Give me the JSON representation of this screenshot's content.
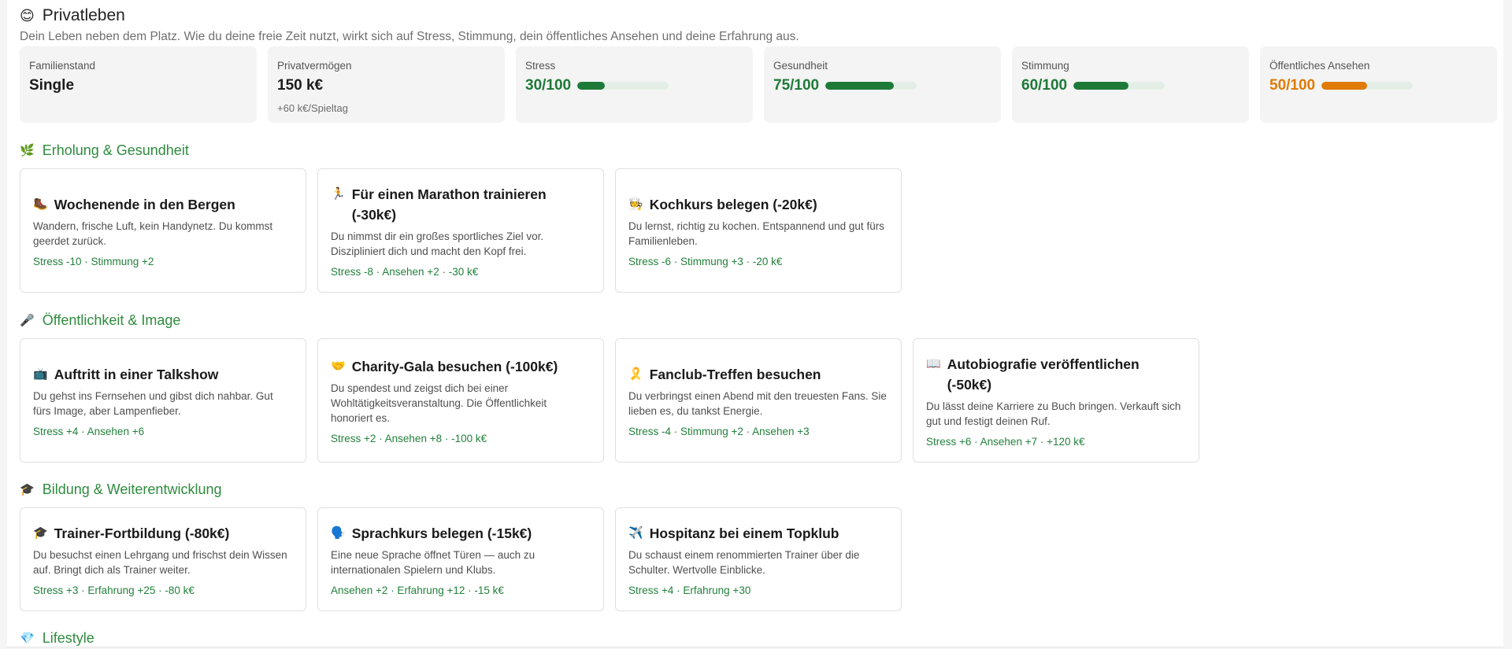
{
  "header": {
    "emoji": "😊",
    "title": "Privatleben",
    "description": "Dein Leben neben dem Platz. Wie du deine freie Zeit nutzt, wirkt sich auf Stress, Stimmung, dein öffentliches Ansehen und deine Erfahrung aus."
  },
  "stats": [
    {
      "label": "Familienstand",
      "value": "Single"
    },
    {
      "label": "Privatvermögen",
      "value": "150 k€",
      "sub": "+60 k€/Spieltag"
    },
    {
      "label": "Stress",
      "value": "30/100",
      "level": 30,
      "color": "#1e7a38"
    },
    {
      "label": "Gesundheit",
      "value": "75/100",
      "level": 75,
      "color": "#1e7a38"
    },
    {
      "label": "Stimmung",
      "value": "60/100",
      "level": 60,
      "color": "#1e7a38"
    },
    {
      "label": "Öffentliches Ansehen",
      "value": "50/100",
      "level": 50,
      "color": "#df7b06"
    }
  ],
  "sections": [
    {
      "emoji": "🌿",
      "title": "Erholung & Gesundheit",
      "cards": [
        {
          "emoji": "🥾",
          "title": "Wochenende in den Bergen",
          "desc": "Wandern, frische Luft, kein Handynetz. Du kommst geerdet zurück.",
          "effects": "Stress -10 · Stimmung +2"
        },
        {
          "emoji": "🏃",
          "title": "Für einen Marathon trainieren (-30k€)",
          "desc": "Du nimmst dir ein großes sportliches Ziel vor. Diszipliniert dich und macht den Kopf frei.",
          "effects": "Stress -8 · Ansehen +2 · -30 k€"
        },
        {
          "emoji": "🧑‍🍳",
          "title": "Kochkurs belegen (-20k€)",
          "desc": "Du lernst, richtig zu kochen. Entspannend und gut fürs Familienleben.",
          "effects": "Stress -6 · Stimmung +3 · -20 k€"
        }
      ]
    },
    {
      "emoji": "🎤",
      "title": "Öffentlichkeit & Image",
      "cards": [
        {
          "emoji": "📺",
          "title": "Auftritt in einer Talkshow",
          "desc": "Du gehst ins Fernsehen und gibst dich nahbar. Gut fürs Image, aber Lampenfieber.",
          "effects": "Stress +4 · Ansehen +6"
        },
        {
          "emoji": "🤝",
          "title": "Charity-Gala besuchen (-100k€)",
          "desc": "Du spendest und zeigst dich bei einer Wohltätigkeitsveranstaltung. Die Öffentlichkeit honoriert es.",
          "effects": "Stress +2 · Ansehen +8 · -100 k€"
        },
        {
          "emoji": "🎗️",
          "title": "Fanclub-Treffen besuchen",
          "desc": "Du verbringst einen Abend mit den treuesten Fans. Sie lieben es, du tankst Energie.",
          "effects": "Stress -4 · Stimmung +2 · Ansehen +3"
        },
        {
          "emoji": "📖",
          "title": "Autobiografie veröffentlichen (-50k€)",
          "desc": "Du lässt deine Karriere zu Buch bringen. Verkauft sich gut und festigt deinen Ruf.",
          "effects": "Stress +6 · Ansehen +7 · +120 k€"
        }
      ]
    },
    {
      "emoji": "🎓",
      "title": "Bildung & Weiterentwicklung",
      "cards": [
        {
          "emoji": "🎓",
          "title": "Trainer-Fortbildung (-80k€)",
          "desc": "Du besuchst einen Lehrgang und frischst dein Wissen auf. Bringt dich als Trainer weiter.",
          "effects": "Stress +3 · Erfahrung +25 · -80 k€"
        },
        {
          "emoji": "🗣️",
          "title": "Sprachkurs belegen (-15k€)",
          "desc": "Eine neue Sprache öffnet Türen — auch zu internationalen Spielern und Klubs.",
          "effects": "Ansehen +2 · Erfahrung +12 · -15 k€"
        },
        {
          "emoji": "✈️",
          "title": "Hospitanz bei einem Topklub",
          "desc": "Du schaust einem renommierten Trainer über die Schulter. Wertvolle Einblicke.",
          "effects": "Stress +4 · Erfahrung +30"
        }
      ]
    },
    {
      "emoji": "💎",
      "title": "Lifestyle",
      "cards": []
    }
  ]
}
